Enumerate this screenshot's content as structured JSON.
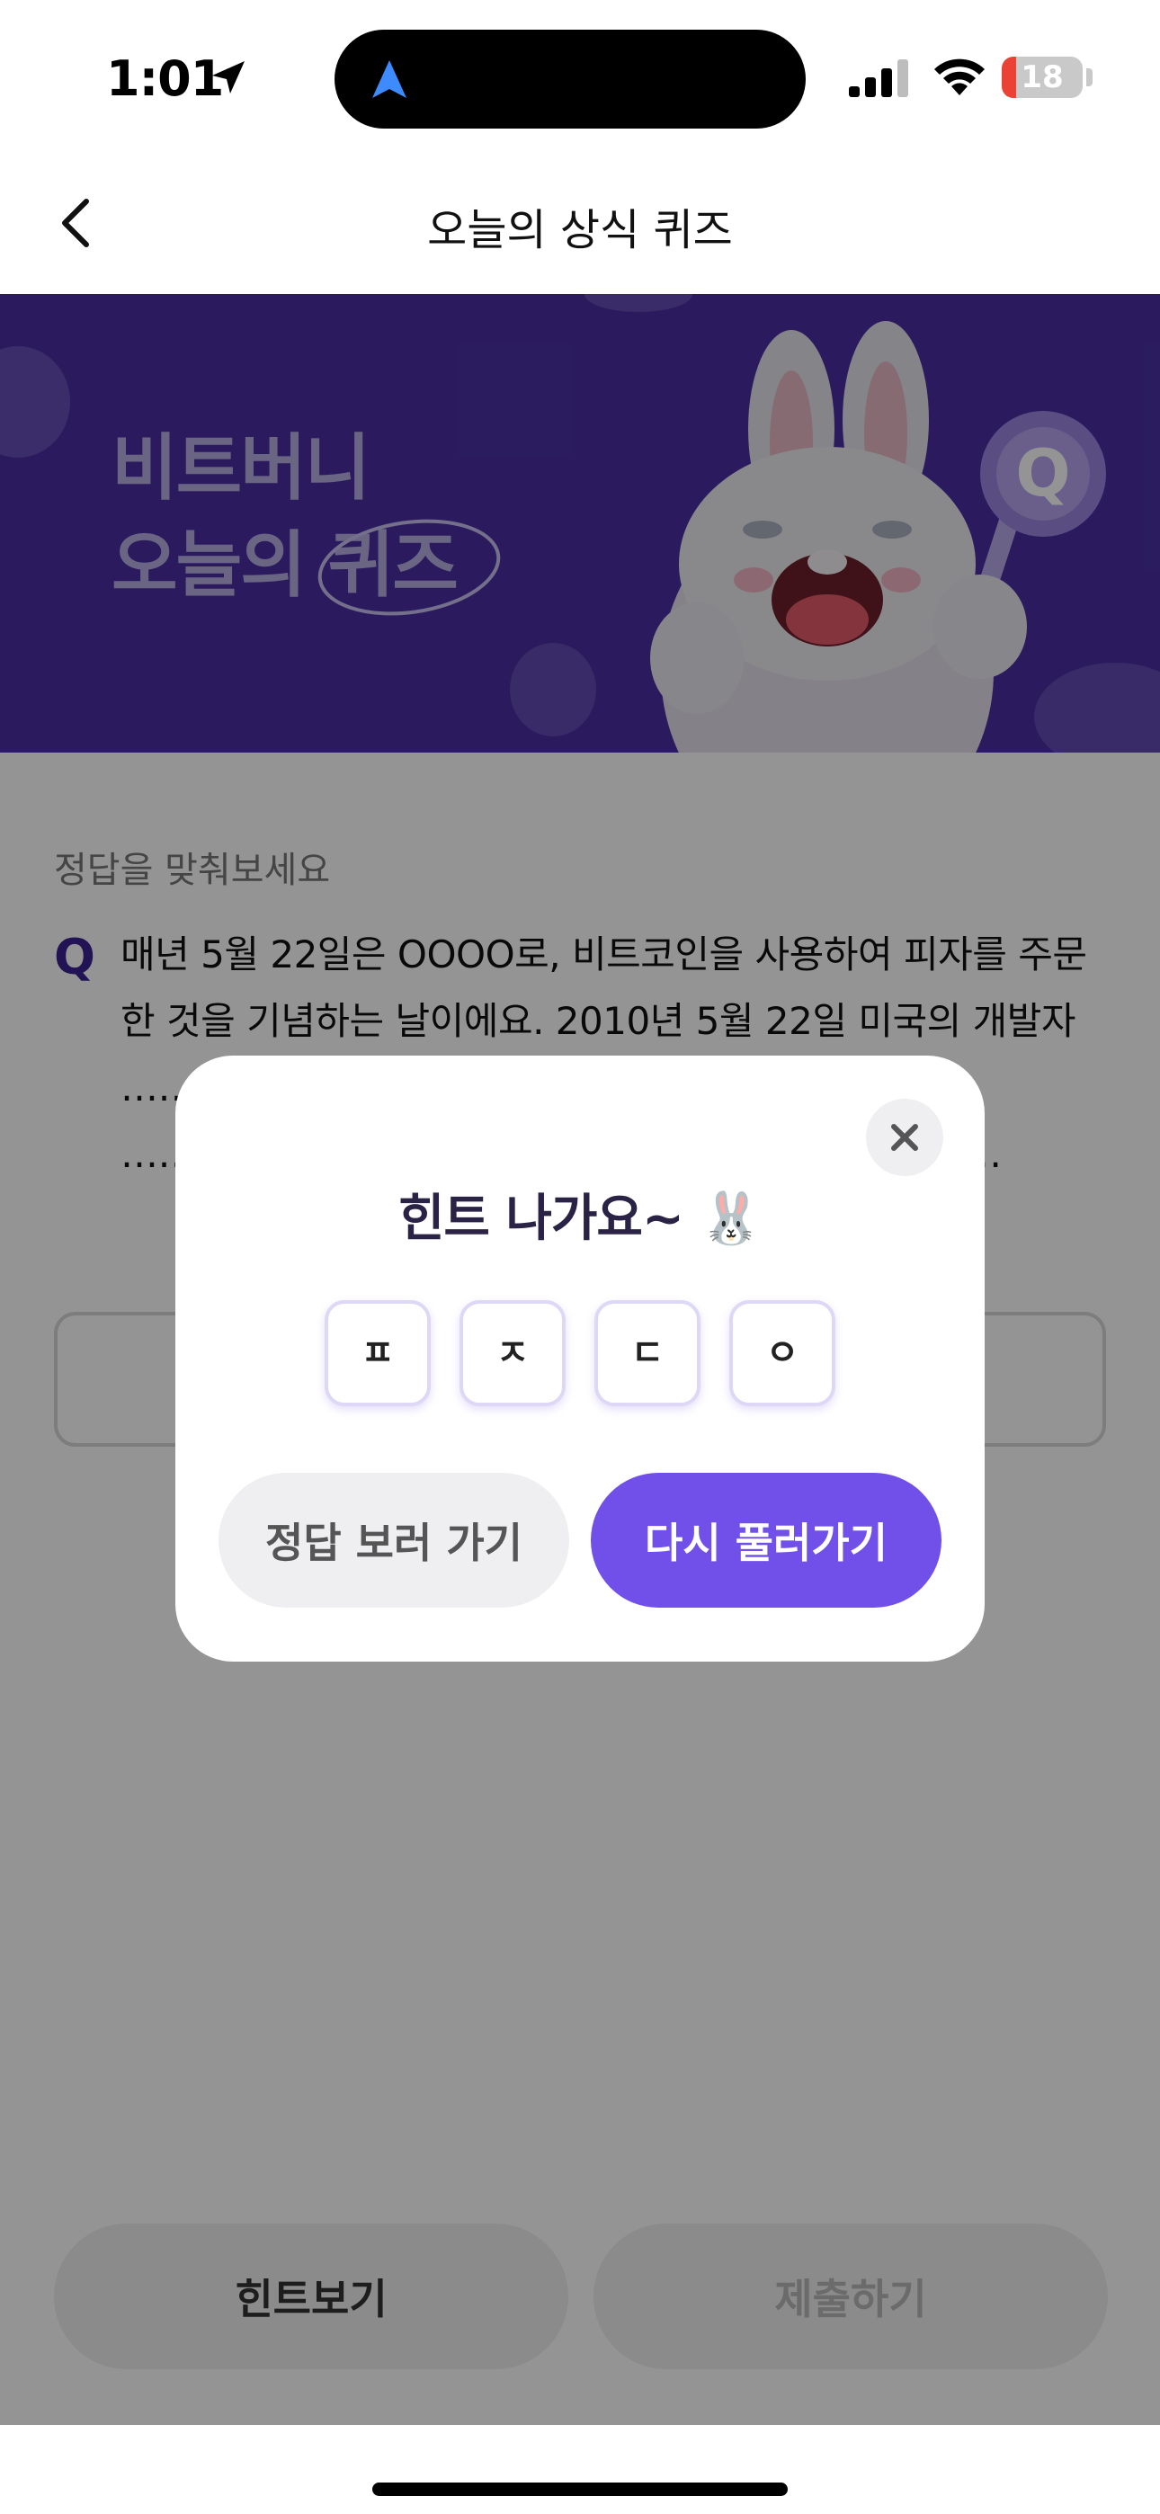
{
  "status_bar": {
    "time": "1:01",
    "battery_level": "18",
    "battery_fraction": 0.18
  },
  "header": {
    "title": "오늘의 상식 퀴즈",
    "back_icon": "chevron-left-icon"
  },
  "banner": {
    "title_line1": "비트버니",
    "title_line2_prefix": "오늘의",
    "title_line2_circled": "퀴즈",
    "background_color": "#4a2fa3"
  },
  "quiz": {
    "instruction": "정답을 맞춰보세요",
    "q_mark": "Q",
    "question": "매년 5월 22일은 OOOO로, 비트코인을 사용하여 피자를 주문한 것을 기념하는 날이에요. 2010년 5월 22일 미국의 개발자 …………………………………………… 하고 피자 ……………………………………………… 한 최초의 …"
  },
  "bottom_buttons": {
    "hint_label": "힌트보기",
    "submit_label": "제출하기"
  },
  "modal": {
    "title": "힌트 나가요~",
    "title_emoji": "🐰",
    "hint_chars": [
      "ㅍ",
      "ㅈ",
      "ㄷ",
      "ㅇ"
    ],
    "see_answer_label": "정답 보러 가기",
    "retry_label": "다시 풀러가기",
    "accent_color": "#7050e8"
  }
}
